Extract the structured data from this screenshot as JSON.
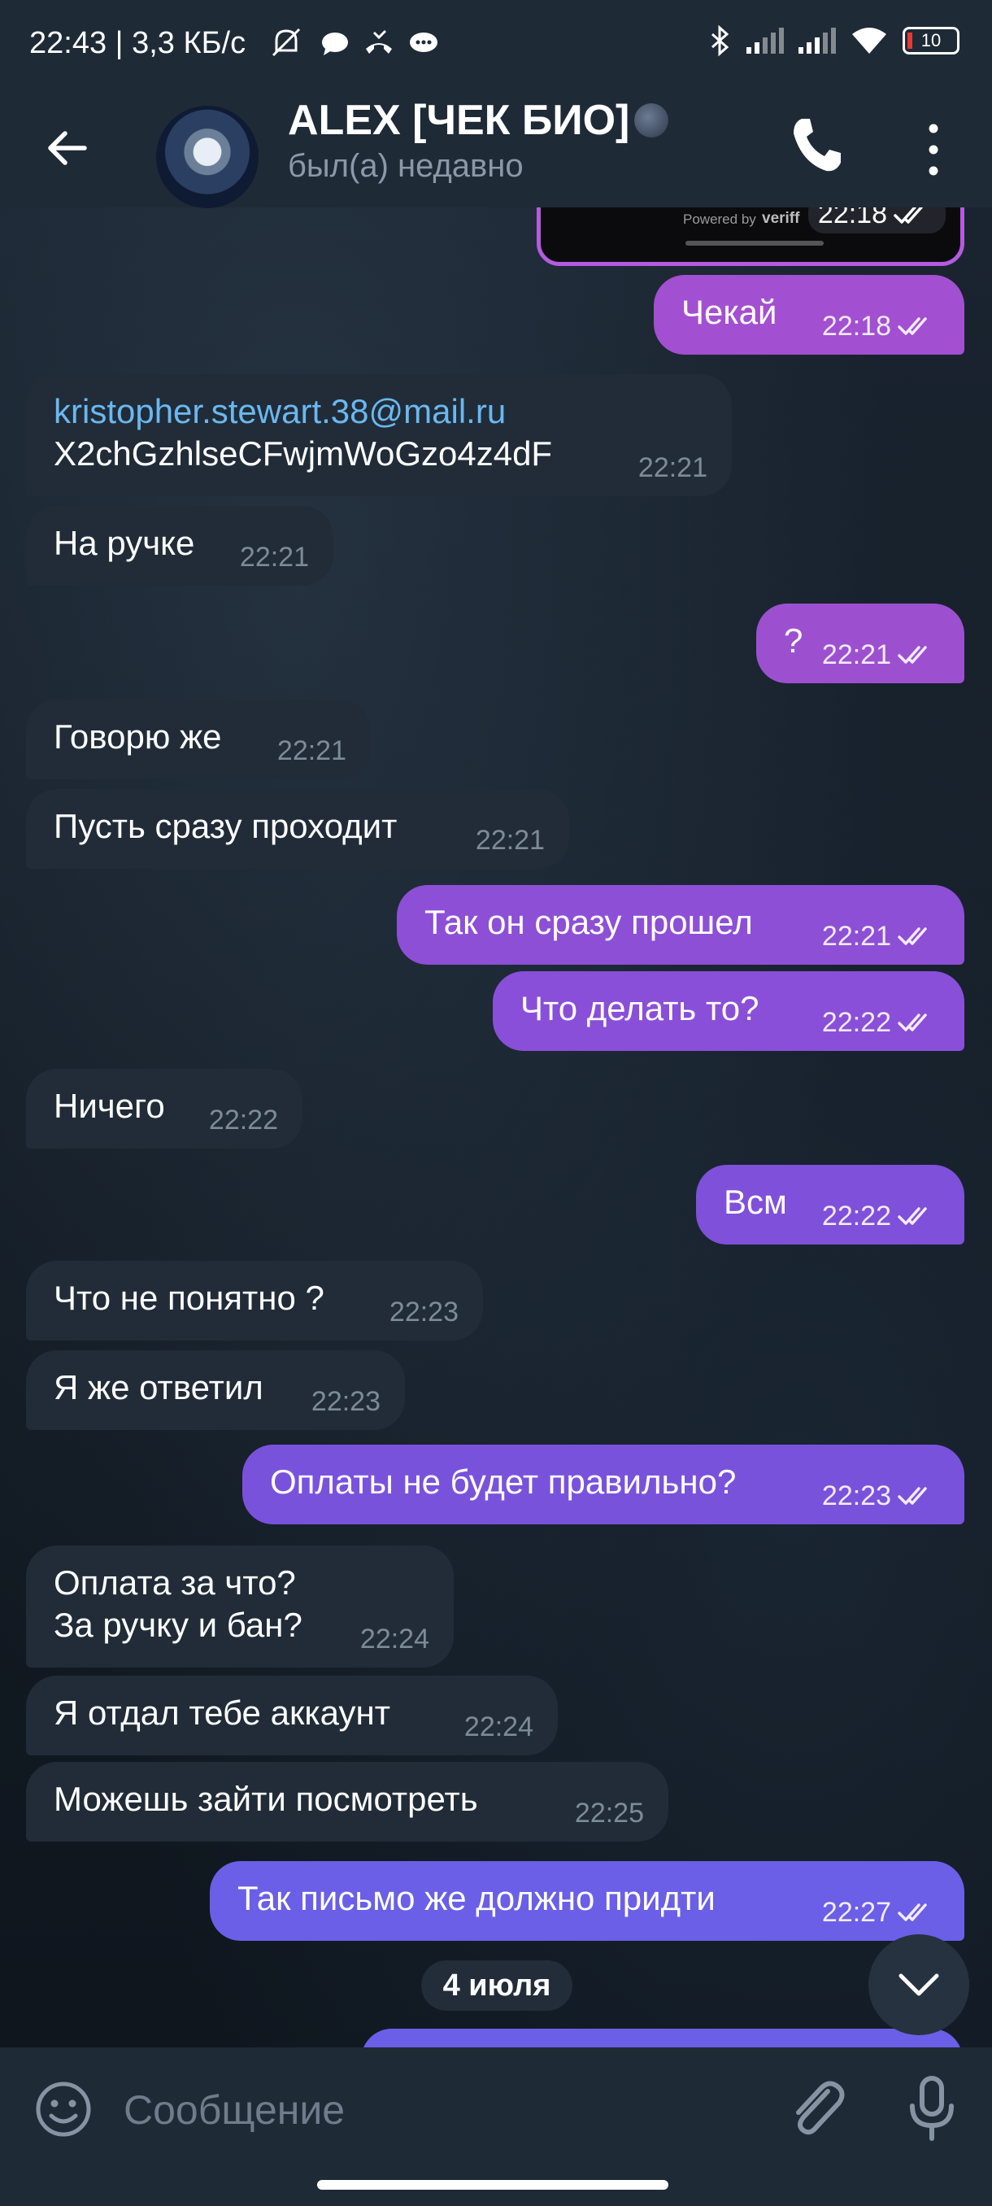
{
  "status_bar": {
    "time": "22:43 | 3,3 КБ/с",
    "battery": "10"
  },
  "header": {
    "title": "ALEX [ЧЕК БИО]",
    "subtitle": "был(а) недавно"
  },
  "prev_media": {
    "powered_by": "Powered by",
    "brand": "veriff",
    "time": "22:18"
  },
  "messages": [
    {
      "dir": "out",
      "text": "Чекай",
      "time": "22:18",
      "color": "#a24fd1"
    },
    {
      "dir": "in",
      "link": "kristopher.stewart.38@mail.ru",
      "text": "X2chGzhlseCFwjmWoGzo4z4dF",
      "time": "22:21"
    },
    {
      "dir": "in",
      "text": "На ручке",
      "time": "22:21"
    },
    {
      "dir": "out",
      "text": "?",
      "time": "22:21",
      "color": "#9c50d0"
    },
    {
      "dir": "in",
      "text": "Говорю же",
      "time": "22:21"
    },
    {
      "dir": "in",
      "text": "Пусть сразу проходит",
      "time": "22:21"
    },
    {
      "dir": "out",
      "text": "Так он сразу прошел",
      "time": "22:21",
      "color": "#8d4fd6"
    },
    {
      "dir": "out",
      "text": "Что делать то?",
      "time": "22:22",
      "color": "#8a4fd8"
    },
    {
      "dir": "in",
      "text": "Ничего",
      "time": "22:22"
    },
    {
      "dir": "out",
      "text": "Всм",
      "time": "22:22",
      "color": "#7f50da"
    },
    {
      "dir": "in",
      "text": "Что не понятно ?",
      "time": "22:23"
    },
    {
      "dir": "in",
      "text": "Я же ответил",
      "time": "22:23"
    },
    {
      "dir": "out",
      "text": "Оплаты не будет правильно?",
      "time": "22:23",
      "color": "#7952dc"
    },
    {
      "dir": "in",
      "text": "Оплата за что?\nЗа ручку и бан?",
      "time": "22:24"
    },
    {
      "dir": "in",
      "text": "Я отдал тебе аккаунт",
      "time": "22:24"
    },
    {
      "dir": "in",
      "text": "Можешь зайти посмотреть",
      "time": "22:25"
    },
    {
      "dir": "out",
      "text": "Так письмо же должно придти",
      "time": "22:27",
      "color": "#6a5fe6"
    }
  ],
  "date_separator": "4 июля",
  "input": {
    "placeholder": "Сообщение"
  },
  "colors": {
    "accent_link": "#6ab8f0",
    "incoming_bubble": "#212c38",
    "bar_background": "#1e2a36"
  }
}
